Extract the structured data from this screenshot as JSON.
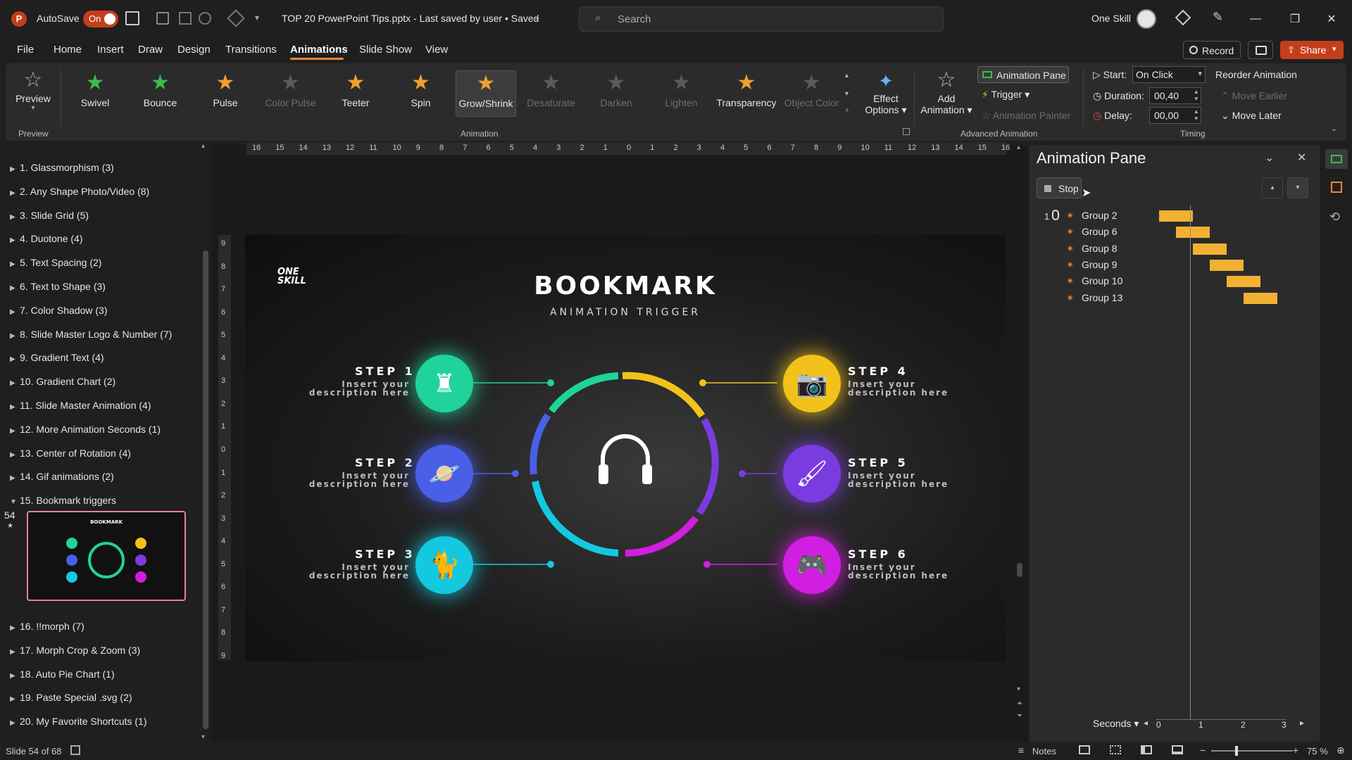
{
  "app": {
    "autosave_label": "AutoSave",
    "autosave_state": "On",
    "document_title": "TOP 20 PowerPoint Tips.pptx  -  Last saved by user  •  Saved",
    "search_placeholder": "Search",
    "user_name": "One Skill"
  },
  "menu": {
    "tabs": [
      "File",
      "Home",
      "Insert",
      "Draw",
      "Design",
      "Transitions",
      "Animations",
      "Slide Show",
      "View"
    ],
    "record_label": "Record",
    "share_label": "Share"
  },
  "ribbon": {
    "preview_label": "Preview",
    "preview_group_label": "Preview",
    "animations": [
      {
        "label": "Swivel",
        "color": "#3fb950",
        "enabled": true
      },
      {
        "label": "Bounce",
        "color": "#3fb950",
        "enabled": true
      },
      {
        "label": "Pulse",
        "color": "#f0a030",
        "enabled": true
      },
      {
        "label": "Color Pulse",
        "color": "#5a5a5a",
        "enabled": false
      },
      {
        "label": "Teeter",
        "color": "#f0a030",
        "enabled": true
      },
      {
        "label": "Spin",
        "color": "#f0a030",
        "enabled": true
      },
      {
        "label": "Grow/Shrink",
        "color": "#f0a030",
        "enabled": true,
        "selected": true
      },
      {
        "label": "Desaturate",
        "color": "#5a5a5a",
        "enabled": false
      },
      {
        "label": "Darken",
        "color": "#5a5a5a",
        "enabled": false
      },
      {
        "label": "Lighten",
        "color": "#5a5a5a",
        "enabled": false
      },
      {
        "label": "Transparency",
        "color": "#f0a030",
        "enabled": true
      },
      {
        "label": "Object Color",
        "color": "#5a5a5a",
        "enabled": false
      }
    ],
    "animation_group_label": "Animation",
    "effect_options_label": "Effect\nOptions",
    "add_animation_label": "Add\nAnimation",
    "animation_pane_label": "Animation Pane",
    "trigger_label": "Trigger",
    "animation_painter_label": "Animation Painter",
    "advanced_group_label": "Advanced Animation",
    "start_label": "Start:",
    "start_value": "On Click",
    "duration_label": "Duration:",
    "duration_value": "00,40",
    "delay_label": "Delay:",
    "delay_value": "00,00",
    "reorder_label": "Reorder Animation",
    "move_earlier_label": "Move Earlier",
    "move_later_label": "Move Later",
    "timing_group_label": "Timing"
  },
  "outline": {
    "sections": [
      "1. Glassmorphism (3)",
      "2. Any Shape Photo/Video (8)",
      "3. Slide Grid (5)",
      "4. Duotone (4)",
      "5. Text Spacing (2)",
      "6. Text to Shape (3)",
      "7. Color Shadow (3)",
      "8. Slide Master Logo & Number (7)",
      "9. Gradient Text (4)",
      "10. Gradient Chart (2)",
      "11. Slide Master Animation (4)",
      "12. More Animation Seconds (1)",
      "13. Center of Rotation (4)",
      "14. Gif animations (2)",
      "15. Bookmark triggers"
    ],
    "slide_number": "54",
    "sections_after": [
      "16. !!morph (7)",
      "17. Morph Crop & Zoom (3)",
      "18. Auto Pie Chart (1)",
      "19. Paste Special .svg (2)",
      "20. My Favorite Shortcuts (1)"
    ]
  },
  "ruler": {
    "h": [
      "16",
      "15",
      "14",
      "13",
      "12",
      "11",
      "10",
      "9",
      "8",
      "7",
      "6",
      "5",
      "4",
      "3",
      "2",
      "1",
      "0",
      "1",
      "2",
      "3",
      "4",
      "5",
      "6",
      "7",
      "8",
      "9",
      "10",
      "11",
      "12",
      "13",
      "14",
      "15",
      "16"
    ],
    "v": [
      "9",
      "8",
      "7",
      "6",
      "5",
      "4",
      "3",
      "2",
      "1",
      "0",
      "1",
      "2",
      "3",
      "4",
      "5",
      "6",
      "7",
      "8",
      "9"
    ]
  },
  "slide": {
    "logo": "ONE\nSKILL",
    "title": "BOOKMARK",
    "subtitle": "ANIMATION TRIGGER",
    "steps": [
      {
        "title": "STEP 1",
        "desc1": "Insert your",
        "desc2": "description here",
        "color": "#20d39a",
        "icon": "chess-icon"
      },
      {
        "title": "STEP 2",
        "desc1": "Insert your",
        "desc2": "description here",
        "color": "#4a5fe8",
        "icon": "planet-icon"
      },
      {
        "title": "STEP 3",
        "desc1": "Insert your",
        "desc2": "description here",
        "color": "#14c8e0",
        "icon": "cat-icon"
      },
      {
        "title": "STEP 4",
        "desc1": "Insert your",
        "desc2": "description here",
        "color": "#f2c21a",
        "icon": "camera-icon"
      },
      {
        "title": "STEP 5",
        "desc1": "Insert your",
        "desc2": "description here",
        "color": "#7a3ce0",
        "icon": "brush-icon"
      },
      {
        "title": "STEP 6",
        "desc1": "Insert your",
        "desc2": "description here",
        "color": "#d21ee0",
        "icon": "gamepad-icon"
      }
    ]
  },
  "anim_pane": {
    "title": "Animation Pane",
    "stop_label": "Stop",
    "trigger_number": "1",
    "items": [
      {
        "label": "Group 2",
        "start": 0.0,
        "duration": 0.4
      },
      {
        "label": "Group 6",
        "start": 0.2,
        "duration": 0.4
      },
      {
        "label": "Group 8",
        "start": 0.4,
        "duration": 0.4
      },
      {
        "label": "Group 9",
        "start": 0.6,
        "duration": 0.4
      },
      {
        "label": "Group 10",
        "start": 0.8,
        "duration": 0.4
      },
      {
        "label": "Group 13",
        "start": 1.0,
        "duration": 0.4
      }
    ],
    "seconds_label": "Seconds",
    "timeline_ticks": [
      "0",
      "1",
      "2",
      "3"
    ]
  },
  "status": {
    "slide_info": "Slide 54 of 68",
    "notes_label": "Notes",
    "zoom": "75 %"
  }
}
